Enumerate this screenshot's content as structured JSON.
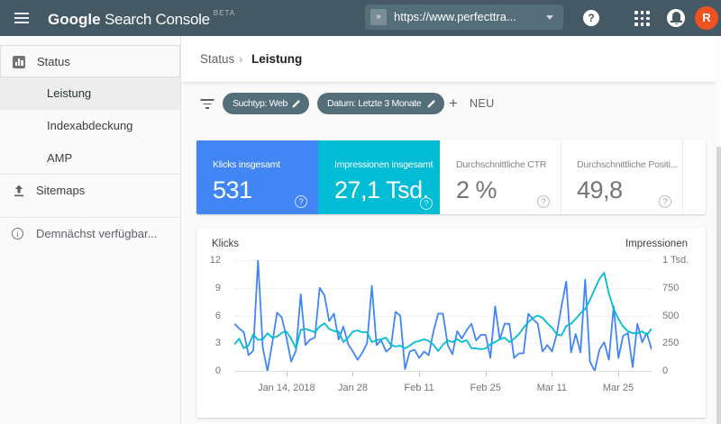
{
  "header": {
    "logo_google": "Google",
    "logo_product": "Search Console",
    "logo_beta": "BETA",
    "property_selector": {
      "badge": "»",
      "value": "https://www.perfecttra..."
    },
    "avatar_initial": "R"
  },
  "sidebar": {
    "status_label": "Status",
    "items": [
      {
        "label": "Leistung"
      },
      {
        "label": "Indexabdeckung"
      },
      {
        "label": "AMP"
      }
    ],
    "sitemaps_label": "Sitemaps",
    "coming_soon_label": "Demnächst verfügbar..."
  },
  "breadcrumb": {
    "section": "Status",
    "page": "Leistung"
  },
  "filters": {
    "chips": [
      {
        "label": "Suchtyp: Web"
      },
      {
        "label": "Datum: Letzte 3 Monate"
      }
    ],
    "new_label": "NEU",
    "new_plus": "+"
  },
  "metrics": [
    {
      "label": "Klicks insgesamt",
      "value": "531",
      "color": "#4285f4",
      "help": "?"
    },
    {
      "label": "Impressionen insgesamt",
      "value": "27,1 Tsd.",
      "color": "#00bcd4",
      "help": "?"
    },
    {
      "label": "Durchschnittliche CTR",
      "value": "2 %",
      "help": "?"
    },
    {
      "label": "Durchschnittliche Positi...",
      "value": "49,8",
      "help": "?"
    }
  ],
  "chart_data": {
    "type": "line",
    "title_left": "Klicks",
    "title_right": "Impressionen",
    "y_left": {
      "labels": [
        "12",
        "9",
        "6",
        "3",
        "0"
      ],
      "max": 12
    },
    "y_right": {
      "labels": [
        "1 Tsd.",
        "750",
        "500",
        "250",
        "0"
      ],
      "max": 1000
    },
    "x_ticks": [
      {
        "label": "Jan 14, 2018",
        "frac": 0.125
      },
      {
        "label": "Jan 28",
        "frac": 0.284
      },
      {
        "label": "Feb 11",
        "frac": 0.443
      },
      {
        "label": "Feb 25",
        "frac": 0.602
      },
      {
        "label": "Mar 11",
        "frac": 0.761
      },
      {
        "label": "Mar 25",
        "frac": 0.92
      }
    ],
    "series": [
      {
        "name": "Klicks",
        "color": "#4285f4",
        "axis_max": 12,
        "values": [
          5.1,
          4.6,
          4.2,
          1.7,
          2.2,
          12,
          2.5,
          0,
          3,
          6.3,
          5.8,
          3.6,
          1,
          2.2,
          8.3,
          2.8,
          3.4,
          3.6,
          9,
          8.2,
          5.4,
          6.2,
          3.4,
          4.8,
          2.9,
          2.1,
          1.2,
          2,
          3,
          9.2,
          2.8,
          3.3,
          2.1,
          2.5,
          6.4,
          6,
          0.2,
          2.1,
          2.3,
          1.4,
          2.1,
          1.7,
          4.3,
          6.2,
          6.2,
          2.8,
          1.8,
          4.3,
          3.5,
          4.4,
          5.1,
          3.3,
          3.9,
          3.9,
          1.4,
          7,
          3.4,
          5.1,
          5.1,
          1.4,
          1.9,
          1.9,
          6.2,
          5.6,
          5.1,
          2.1,
          2.8,
          2.1,
          4,
          7,
          9.7,
          2,
          4,
          2,
          9.9,
          1,
          0,
          2.3,
          3.1,
          1.2,
          7,
          1.4,
          3.8,
          4.1,
          0.4,
          5.1,
          3.1,
          4.1,
          2.3
        ]
      },
      {
        "name": "Impressionen",
        "color": "#00bcd4",
        "axis_max": 1000,
        "values": [
          240,
          290,
          205,
          230,
          330,
          280,
          285,
          340,
          300,
          310,
          345,
          355,
          290,
          205,
          370,
          380,
          365,
          350,
          400,
          430,
          380,
          360,
          355,
          260,
          300,
          355,
          365,
          350,
          350,
          260,
          277,
          285,
          300,
          236,
          220,
          228,
          203,
          228,
          260,
          270,
          285,
          270,
          236,
          180,
          236,
          275,
          260,
          285,
          260,
          277,
          205,
          203,
          195,
          203,
          240,
          260,
          285,
          300,
          260,
          290,
          330,
          390,
          440,
          480,
          500,
          480,
          430,
          390,
          330,
          320,
          405,
          425,
          470,
          520,
          560,
          640,
          740,
          830,
          886,
          700,
          560,
          470,
          400,
          358,
          340,
          340,
          358,
          325,
          380
        ]
      }
    ]
  }
}
